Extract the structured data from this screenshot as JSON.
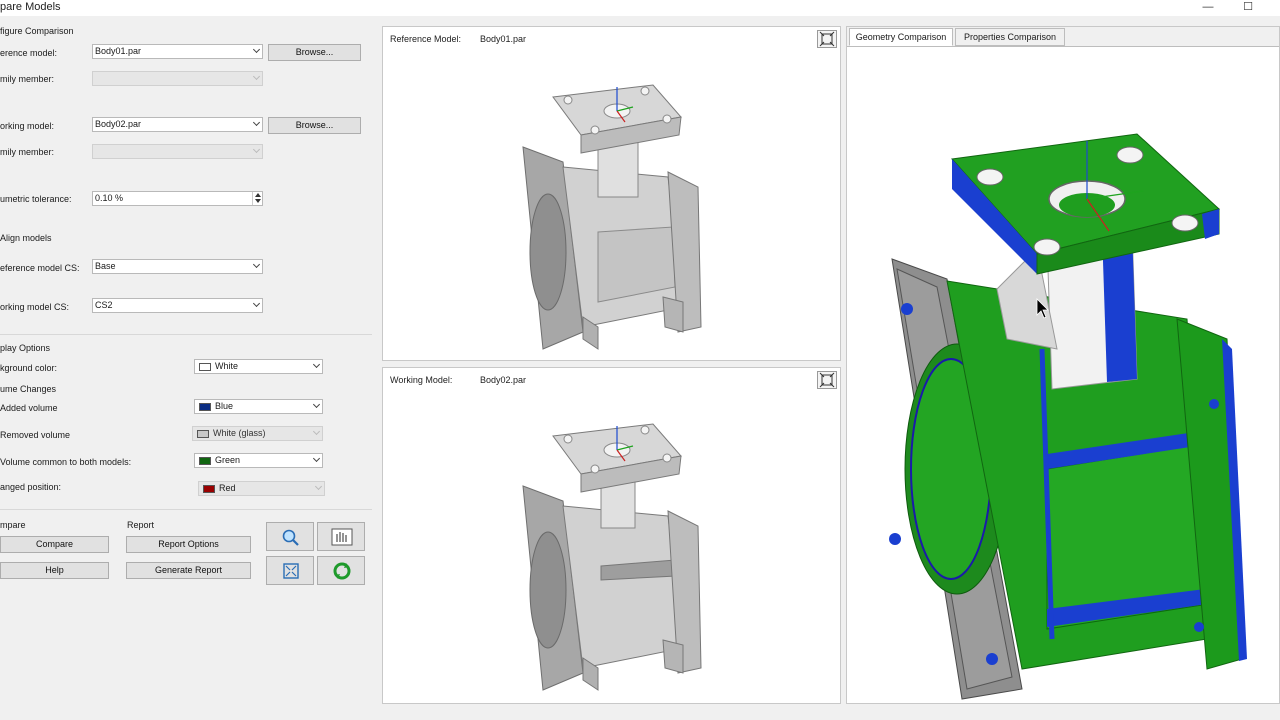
{
  "window": {
    "title": "pare Models",
    "minimize_glyph": "—",
    "maximize_glyph": "☐"
  },
  "configure": {
    "heading": "figure Comparison",
    "reference_model_label": "erence model:",
    "reference_model_value": "Body01.par",
    "reference_family_label": "mily member:",
    "working_model_label": "orking model:",
    "working_model_value": "Body02.par",
    "working_family_label": "mily member:",
    "browse_label": "Browse...",
    "tolerance_label": "umetric tolerance:",
    "tolerance_value": "0.10 %",
    "align_label": "Align models",
    "reference_cs_label": "eference model CS:",
    "reference_cs_value": "Base",
    "working_cs_label": "orking model CS:",
    "working_cs_value": "CS2"
  },
  "display": {
    "heading": "play Options",
    "background_label": "kground color:",
    "background_value": "White",
    "volume_heading": "ume Changes",
    "added_label": "Added volume",
    "added_value": "Blue",
    "removed_label": "Removed volume",
    "removed_value": "White (glass)",
    "common_label": "Volume common to both models:",
    "common_value": "Green",
    "changed_label": "anged position:",
    "changed_value": "Red",
    "colors": {
      "white": "#ffffff",
      "blue": "#0b2d83",
      "glass": "#c8c8c8",
      "green": "#116611",
      "red": "#990000"
    }
  },
  "actions": {
    "compare_heading": "mpare",
    "compare_label": "Compare",
    "help_label": "Help",
    "report_heading": "Report",
    "report_options_label": "Report Options",
    "generate_report_label": "Generate Report",
    "icons": [
      "zoom-icon",
      "pan-hand-icon",
      "fit-view-icon",
      "refresh-icon"
    ]
  },
  "reference_view": {
    "header_label": "Reference Model:",
    "file": "Body01.par"
  },
  "working_view": {
    "header_label": "Working Model:",
    "file": "Body02.par"
  },
  "comparison": {
    "tabs": [
      "Geometry Comparison",
      "Properties Comparison"
    ],
    "active_tab": "Geometry Comparison",
    "common_color": "#1f9e1f",
    "added_color": "#1a3fd0",
    "removed_color": "#f2f2f2"
  }
}
